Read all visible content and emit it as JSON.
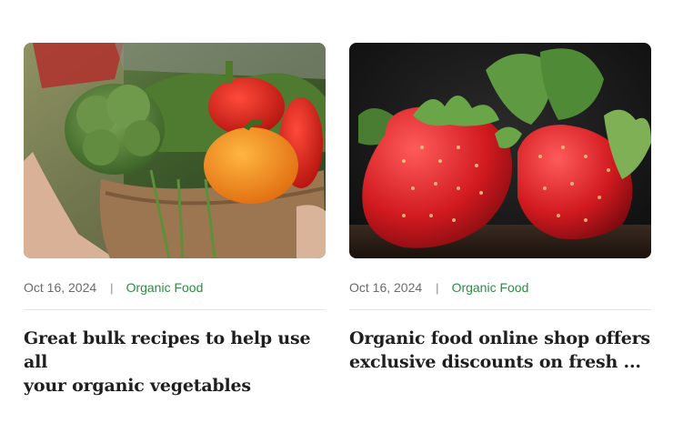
{
  "posts": [
    {
      "image_alt": "Basket of broccoli, bell peppers and herbs",
      "date": "Oct 16, 2024",
      "separator": "|",
      "category": "Organic Food",
      "title_line1": "Great bulk recipes to help use all",
      "title_line2": "your organic vegetables"
    },
    {
      "image_alt": "Two fresh strawberries with leaves",
      "date": "Oct 16, 2024",
      "separator": "|",
      "category": "Organic Food",
      "title_line1": "Organic food online shop offers",
      "title_line2": "exclusive discounts on fresh ..."
    }
  ],
  "colors": {
    "category": "#2e8b43",
    "meta_text": "#6b6b6b",
    "title_text": "#1f1f1f",
    "divider": "#e6e6e6"
  }
}
